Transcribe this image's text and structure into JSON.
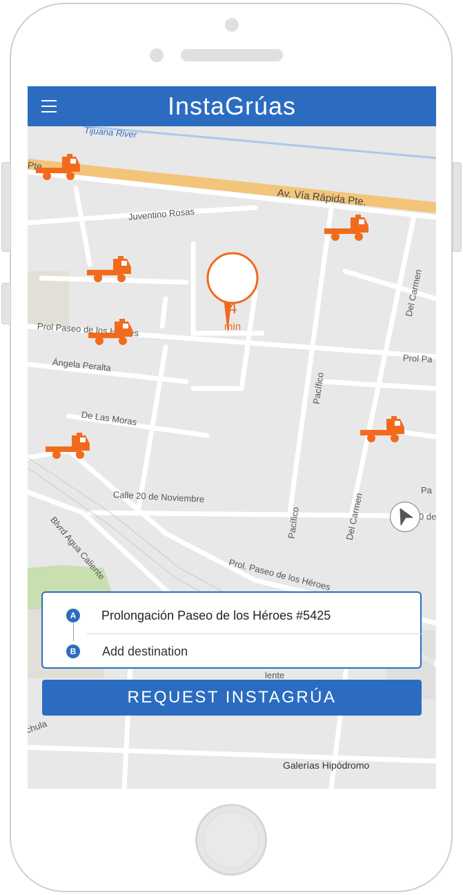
{
  "app": {
    "title": "InstaGrúas"
  },
  "map": {
    "streets": {
      "tijuana_river": "Tijuana River",
      "pte": "Pte.",
      "via_rapida": "Av. Vía Rápida Pte.",
      "juventino_rosas": "Juventino Rosas",
      "prol_paseo_heroes": "Prol Paseo de los Héroes",
      "prol_pa": "Prol Pa",
      "angela_peralta": "Ángela Peralta",
      "de_las_moras": "De Las Moras",
      "pacifico_upper": "Pacífico",
      "pacifico_lower": "Pacífico",
      "del_carmen_upper": "Del Carmen",
      "del_carmen_lower": "Del Carmen",
      "calle_20_noviembre": "Calle 20 de Noviembre",
      "blvrd_agua_caliente": "Blvrd Agua Caliente",
      "prol_paseo_heroes_2": "Prol. Paseo de los Héroes",
      "pa_partial": "Pa",
      "chula_partial": "chula",
      "galerias": "Galerías Hipódromo",
      "lente_partial": "lente",
      "de_partial": "0 de"
    },
    "eta": {
      "value": "4",
      "unit": "min"
    },
    "icons": {
      "truck": "tow-truck-icon",
      "locate": "navigation-arrow-icon"
    },
    "colors": {
      "accent": "#2b6cc0",
      "truck": "#f26b1d"
    }
  },
  "trip": {
    "origin_badge": "A",
    "origin": "Prolongación Paseo de los Héroes #5425",
    "destination_badge": "B",
    "destination_placeholder": "Add destination"
  },
  "actions": {
    "request_label": "REQUEST INSTAGRÚA"
  }
}
